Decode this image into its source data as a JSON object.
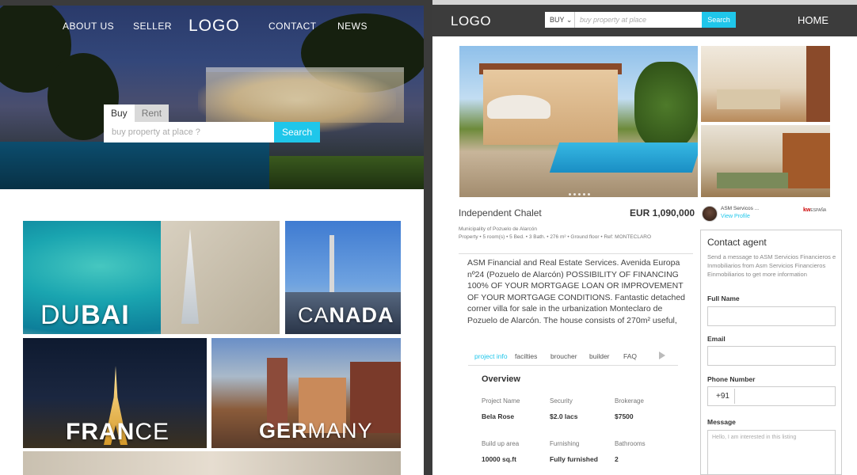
{
  "left": {
    "nav": {
      "about": "ABOUT US",
      "seller": "SELLER",
      "logo": "LOGO",
      "contact": "CONTACT",
      "news": "NEWS"
    },
    "search": {
      "tab_buy": "Buy",
      "tab_rent": "Rent",
      "placeholder": "buy property at place ?",
      "button": "Search"
    },
    "destinations": [
      {
        "light": "DU",
        "bold": "BAI"
      },
      {
        "light": "CA",
        "bold": "NADA"
      },
      {
        "light": "",
        "bold": "FRAN",
        "tail": "CE"
      },
      {
        "light": "",
        "bold": "GER",
        "tail": "MANY"
      }
    ]
  },
  "right": {
    "nav": {
      "logo": "LOGO",
      "select": "BUY",
      "placeholder": "buy property at place",
      "button": "Search",
      "home": "HOME"
    },
    "property": {
      "title": "Independent Chalet",
      "price": "EUR 1,090,000",
      "meta_location": "Municipality of Pozuelo de Alarcón",
      "meta_details": "Property • 5 room(s) • 5 Bed. • 3 Bath. • 276 m² • Ground floor • Ref: MONTECLARO",
      "description": "ASM Financial and Real Estate Services. Avenida Europa nº24 (Pozuelo de Alarcón) POSSIBILITY OF FINANCING  100% OF YOUR MORTGAGE LOAN OR IMPROVEMENT OF YOUR MORTGAGE CONDITIONS. Fantastic detached corner villa for sale in the urbanization Monteclaro de Pozuelo de Alarcón. The house consists of 270m² useful,"
    },
    "tabs": [
      "project info",
      "facilties",
      "broucher",
      "builder",
      "FAQ"
    ],
    "overview": {
      "title": "Overview",
      "items": [
        {
          "k": "Project Name",
          "v": "Bela Rose"
        },
        {
          "k": "Security",
          "v": "$2.0 lacs"
        },
        {
          "k": "Brokerage",
          "v": "$7500"
        },
        {
          "k": "Build up area",
          "v": "10000 sq.ft"
        },
        {
          "k": "Furnishing",
          "v": "Fully furnished"
        },
        {
          "k": "Bathrooms",
          "v": "2"
        }
      ]
    },
    "agent": {
      "name": "ASM Servicos ...",
      "link": "View Profile",
      "brand": "kw",
      "brand_sub": "ESPAÑA"
    },
    "contact": {
      "title": "Contact agent",
      "subtitle": "Send a message to ASM Servicios Financieros e Inmobiliarios from Asm Servicios Financieros Einmobiliarios to get  more information",
      "full_name": "Full Name",
      "email": "Email",
      "phone": "Phone Number",
      "phone_code": "+91",
      "message": "Message",
      "message_placeholder": "Hello, I am interested in this listing"
    }
  }
}
